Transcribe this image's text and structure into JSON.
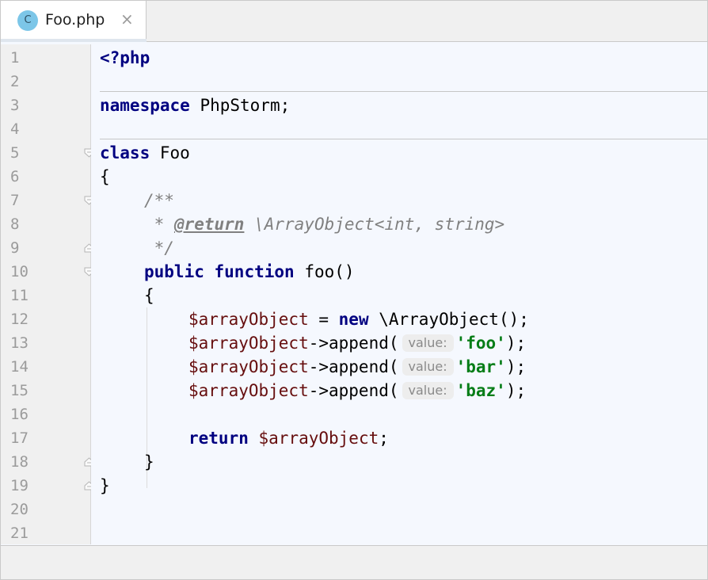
{
  "tab": {
    "icon_letter": "C",
    "icon_name": "php-class-icon",
    "label": "Foo.php",
    "close_glyph": "×"
  },
  "gutter": {
    "line_numbers": [
      "1",
      "2",
      "3",
      "4",
      "5",
      "6",
      "7",
      "8",
      "9",
      "10",
      "11",
      "12",
      "13",
      "14",
      "15",
      "16",
      "17",
      "18",
      "19",
      "20",
      "21"
    ]
  },
  "code": {
    "l1": {
      "kw": "<?php"
    },
    "l3": {
      "kw": "namespace",
      "name": " PhpStorm;"
    },
    "l5": {
      "kw": "class",
      "name": " Foo"
    },
    "l6": {
      "text": "{"
    },
    "l7": {
      "comment": "/**"
    },
    "l8": {
      "star": " * ",
      "tag": "@return",
      "type": " \\ArrayObject<int, string>"
    },
    "l9": {
      "comment": " */"
    },
    "l10": {
      "kw1": "public",
      "kw2": "function",
      "name": " foo()"
    },
    "l11": {
      "text": "{"
    },
    "l12": {
      "var": "$arrayObject",
      "eq": " = ",
      "kw": "new",
      "rest": " \\ArrayObject();"
    },
    "l13": {
      "var": "$arrayObject",
      "call": "->append(",
      "hint": "value:",
      "str": "'foo'",
      "end": ");"
    },
    "l14": {
      "var": "$arrayObject",
      "call": "->append(",
      "hint": "value:",
      "str": "'bar'",
      "end": ");"
    },
    "l15": {
      "var": "$arrayObject",
      "call": "->append(",
      "hint": "value:",
      "str": "'baz'",
      "end": ");"
    },
    "l17": {
      "kw": "return",
      "sp": " ",
      "var": "$arrayObject",
      "end": ";"
    },
    "l18": {
      "text": "}"
    },
    "l19": {
      "text": "}"
    }
  },
  "colors": {
    "keyword": "#000080",
    "variable": "#660e0e",
    "string": "#067d17",
    "comment": "#808080",
    "editor_bg": "#f5f8fe",
    "gutter_bg": "#f0f0f0"
  }
}
